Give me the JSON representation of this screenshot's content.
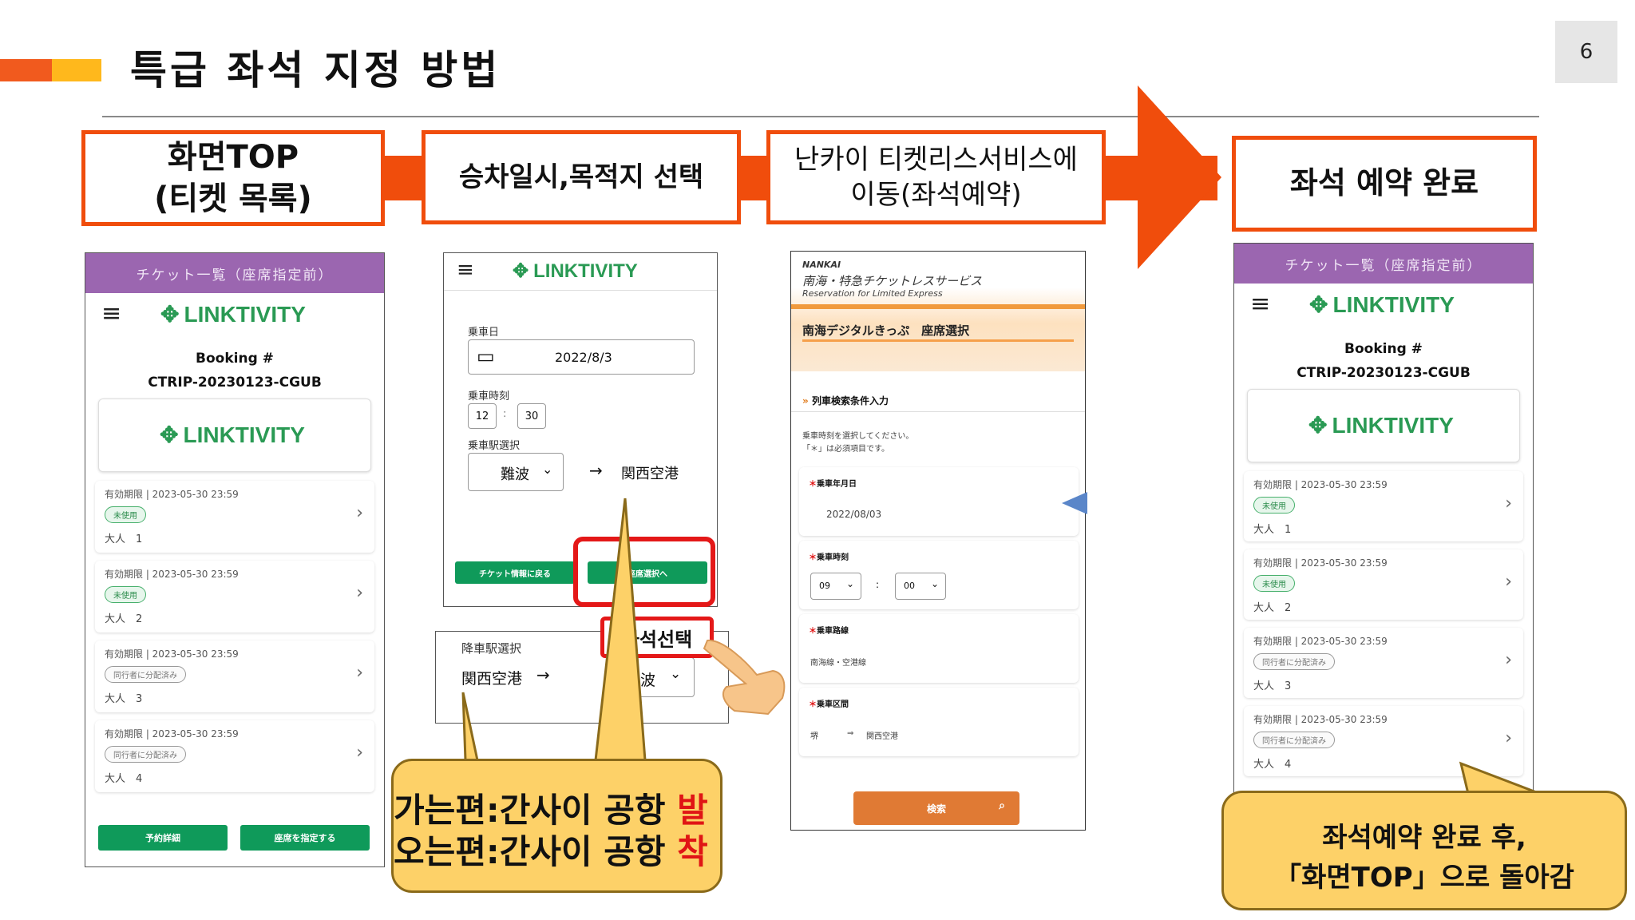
{
  "header": {
    "title": "특급 좌석 지정 방법",
    "page_number": "6"
  },
  "flow": {
    "steps": [
      {
        "line1": "화면TOP",
        "line2": "(티켓 목록)"
      },
      {
        "line1": "승차일시,목적지 선택"
      },
      {
        "line1": "난카이 티켓리스서비스에",
        "line2": "이동(좌석예약)"
      },
      {
        "line1": "좌석 예약 완료"
      }
    ]
  },
  "screen1": {
    "header_bar": "チケット一覧（座席指定前）",
    "logo": "LINKTIVITY",
    "booking_label": "Booking #",
    "booking_id": "CTRIP-20230123-CGUB",
    "card_logo": "LINKTIVITY",
    "tickets": [
      {
        "valid": "有効期限 | 2023-05-30 23:59",
        "status": "未使用",
        "count": "大人　1"
      },
      {
        "valid": "有効期限 | 2023-05-30 23:59",
        "status": "未使用",
        "count": "大人　2"
      },
      {
        "valid": "有効期限 | 2023-05-30 23:59",
        "status": "同行者に分配済み",
        "count": "大人　3"
      },
      {
        "valid": "有効期限 | 2023-05-30 23:59",
        "status": "同行者に分配済み",
        "count": "大人　4"
      }
    ],
    "btn_details": "予約詳細",
    "btn_assign": "座席を指定する"
  },
  "screen2": {
    "logo": "LINKTIVITY",
    "date_label": "乗車日",
    "date_value": "2022/8/3",
    "time_label": "乗車時刻",
    "hour": "12",
    "minute": "30",
    "station_label": "乗車駅選択",
    "from_station": "難波",
    "arrow": "→",
    "to_station": "関西空港",
    "btn_back": "チケット情報に戻る",
    "btn_seat": "座席選択へ"
  },
  "screen2_return": {
    "label": "降車駅選択",
    "from_station": "関西空港",
    "arrow": "→",
    "to_station": "難波"
  },
  "seat_select_label": "좌석선택",
  "callout_route": {
    "line1_pre": "가는편:간사이 공항 ",
    "line1_red": "발",
    "line2_pre": "오는편:간사이 공항 ",
    "line2_red": "착"
  },
  "screen3": {
    "brand": "NANKAI",
    "title": "南海・特急チケットレスサービス",
    "subtitle": "Reservation for Limited Express",
    "section": "南海デジタルきっぷ　座席選択",
    "search_title": "列車検索条件入力",
    "instruction1": "乗車時刻を選択してください。",
    "instruction2": "「＊」は必須項目です。",
    "date_label": "乗車年月日",
    "date_value": "2022/08/03",
    "time_label": "乗車時刻",
    "hour": "09",
    "minute": "00",
    "line_label": "乗車路線",
    "line_value": "南海線・空港線",
    "section_label": "乗車区間",
    "from": "堺",
    "arrow": "⇒",
    "to": "関西空港",
    "search_btn": "検索"
  },
  "screen4": {
    "header_bar": "チケット一覧（座席指定前）",
    "logo": "LINKTIVITY",
    "booking_label": "Booking #",
    "booking_id": "CTRIP-20230123-CGUB",
    "card_logo": "LINKTIVITY",
    "tickets": [
      {
        "valid": "有効期限 | 2023-05-30 23:59",
        "status": "未使用",
        "count": "大人　1"
      },
      {
        "valid": "有効期限 | 2023-05-30 23:59",
        "status": "未使用",
        "count": "大人　2"
      },
      {
        "valid": "有効期限 | 2023-05-30 23:59",
        "status": "同行者に分配済み",
        "count": "大人　3"
      },
      {
        "valid": "有効期限 | 2023-05-30 23:59",
        "status": "同行者に分配済み",
        "count": "大人　4"
      }
    ]
  },
  "callout_done": {
    "line1": "좌석예약 완료 후,",
    "line2": "「화면TOP」으로 돌아감"
  },
  "colors": {
    "accent": "#f04d0c",
    "purple": "#9b66b0",
    "green": "#0f9a5a",
    "callout": "#fdd168"
  }
}
